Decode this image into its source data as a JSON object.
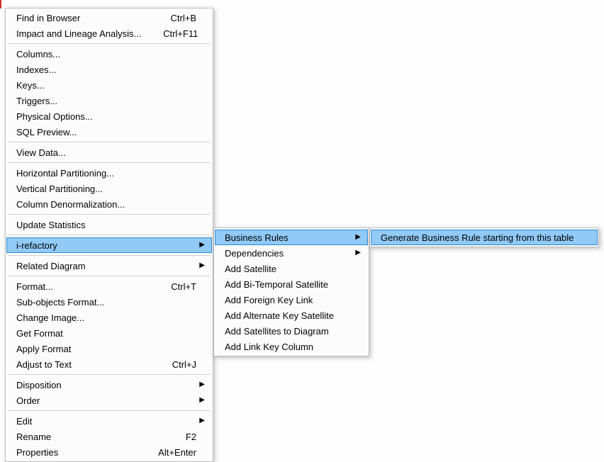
{
  "menu1": {
    "groups": [
      [
        {
          "label": "Find in Browser",
          "shortcut": "Ctrl+B",
          "submenu": false,
          "highlight": false,
          "name": "menu-find-in-browser"
        },
        {
          "label": "Impact and Lineage Analysis...",
          "shortcut": "Ctrl+F11",
          "submenu": false,
          "highlight": false,
          "name": "menu-impact-lineage-analysis"
        }
      ],
      [
        {
          "label": "Columns...",
          "shortcut": "",
          "submenu": false,
          "highlight": false,
          "name": "menu-columns"
        },
        {
          "label": "Indexes...",
          "shortcut": "",
          "submenu": false,
          "highlight": false,
          "name": "menu-indexes"
        },
        {
          "label": "Keys...",
          "shortcut": "",
          "submenu": false,
          "highlight": false,
          "name": "menu-keys"
        },
        {
          "label": "Triggers...",
          "shortcut": "",
          "submenu": false,
          "highlight": false,
          "name": "menu-triggers"
        },
        {
          "label": "Physical Options...",
          "shortcut": "",
          "submenu": false,
          "highlight": false,
          "name": "menu-physical-options"
        },
        {
          "label": "SQL Preview...",
          "shortcut": "",
          "submenu": false,
          "highlight": false,
          "name": "menu-sql-preview"
        }
      ],
      [
        {
          "label": "View Data...",
          "shortcut": "",
          "submenu": false,
          "highlight": false,
          "name": "menu-view-data"
        }
      ],
      [
        {
          "label": "Horizontal Partitioning...",
          "shortcut": "",
          "submenu": false,
          "highlight": false,
          "name": "menu-horizontal-partitioning"
        },
        {
          "label": "Vertical Partitioning...",
          "shortcut": "",
          "submenu": false,
          "highlight": false,
          "name": "menu-vertical-partitioning"
        },
        {
          "label": "Column Denormalization...",
          "shortcut": "",
          "submenu": false,
          "highlight": false,
          "name": "menu-column-denormalization"
        }
      ],
      [
        {
          "label": "Update Statistics",
          "shortcut": "",
          "submenu": false,
          "highlight": false,
          "name": "menu-update-statistics"
        }
      ],
      [
        {
          "label": "i-refactory",
          "shortcut": "",
          "submenu": true,
          "highlight": true,
          "name": "menu-i-refactory"
        }
      ],
      [
        {
          "label": "Related Diagram",
          "shortcut": "",
          "submenu": true,
          "highlight": false,
          "name": "menu-related-diagram"
        }
      ],
      [
        {
          "label": "Format...",
          "shortcut": "Ctrl+T",
          "submenu": false,
          "highlight": false,
          "name": "menu-format"
        },
        {
          "label": "Sub-objects Format...",
          "shortcut": "",
          "submenu": false,
          "highlight": false,
          "name": "menu-sub-objects-format"
        },
        {
          "label": "Change Image...",
          "shortcut": "",
          "submenu": false,
          "highlight": false,
          "name": "menu-change-image"
        },
        {
          "label": "Get Format",
          "shortcut": "",
          "submenu": false,
          "highlight": false,
          "name": "menu-get-format"
        },
        {
          "label": "Apply Format",
          "shortcut": "",
          "submenu": false,
          "highlight": false,
          "name": "menu-apply-format"
        },
        {
          "label": "Adjust to Text",
          "shortcut": "Ctrl+J",
          "submenu": false,
          "highlight": false,
          "name": "menu-adjust-to-text"
        }
      ],
      [
        {
          "label": "Disposition",
          "shortcut": "",
          "submenu": true,
          "highlight": false,
          "name": "menu-disposition"
        },
        {
          "label": "Order",
          "shortcut": "",
          "submenu": true,
          "highlight": false,
          "name": "menu-order"
        }
      ],
      [
        {
          "label": "Edit",
          "shortcut": "",
          "submenu": true,
          "highlight": false,
          "name": "menu-edit"
        },
        {
          "label": "Rename",
          "shortcut": "F2",
          "submenu": false,
          "highlight": false,
          "name": "menu-rename"
        },
        {
          "label": "Properties",
          "shortcut": "Alt+Enter",
          "submenu": false,
          "highlight": false,
          "name": "menu-properties"
        }
      ]
    ]
  },
  "menu2": {
    "groups": [
      [
        {
          "label": "Business Rules",
          "shortcut": "",
          "submenu": true,
          "highlight": true,
          "name": "menu-business-rules"
        },
        {
          "label": "Dependencies",
          "shortcut": "",
          "submenu": true,
          "highlight": false,
          "name": "menu-dependencies"
        },
        {
          "label": "Add Satellite",
          "shortcut": "",
          "submenu": false,
          "highlight": false,
          "name": "menu-add-satellite"
        },
        {
          "label": "Add Bi-Temporal Satellite",
          "shortcut": "",
          "submenu": false,
          "highlight": false,
          "name": "menu-add-bi-temporal-satellite"
        },
        {
          "label": "Add Foreign Key Link",
          "shortcut": "",
          "submenu": false,
          "highlight": false,
          "name": "menu-add-foreign-key-link"
        },
        {
          "label": "Add Alternate Key Satellite",
          "shortcut": "",
          "submenu": false,
          "highlight": false,
          "name": "menu-add-alternate-key-satellite"
        },
        {
          "label": "Add Satellites to Diagram",
          "shortcut": "",
          "submenu": false,
          "highlight": false,
          "name": "menu-add-satellites-to-diagram"
        },
        {
          "label": "Add Link Key Column",
          "shortcut": "",
          "submenu": false,
          "highlight": false,
          "name": "menu-add-link-key-column"
        }
      ]
    ]
  },
  "menu3": {
    "groups": [
      [
        {
          "label": "Generate Business Rule starting from this table",
          "shortcut": "",
          "submenu": false,
          "highlight": true,
          "name": "menu-generate-business-rule-from-table"
        }
      ]
    ]
  },
  "arrow_glyph": "▶"
}
